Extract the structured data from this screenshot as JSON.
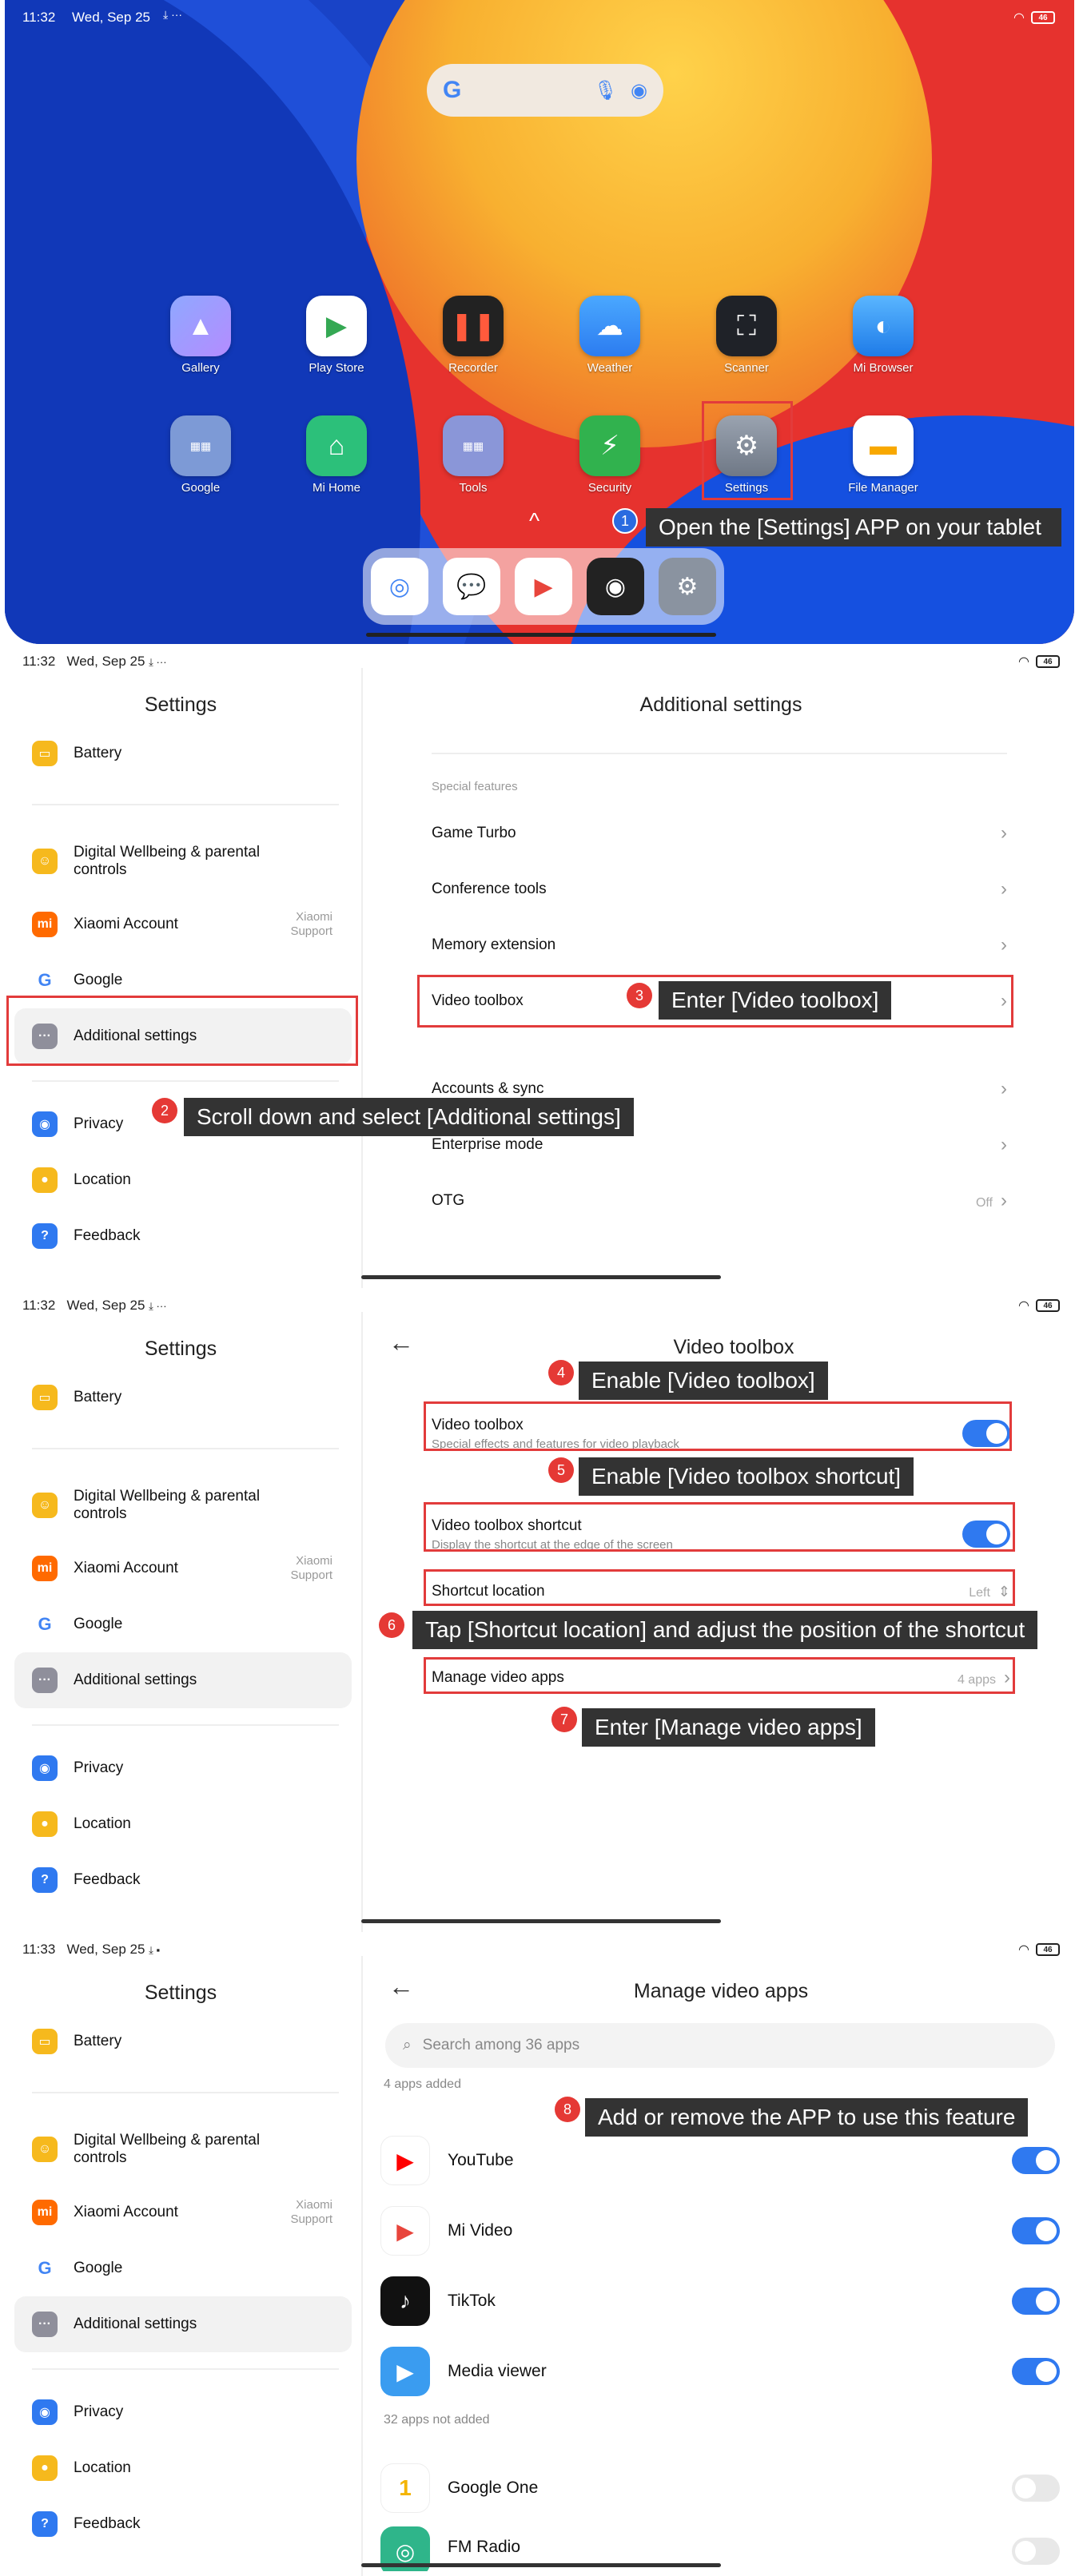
{
  "status": {
    "time1": "11:32",
    "date1": "Wed, Sep 25",
    "time4": "11:33",
    "battery": "46"
  },
  "home": {
    "apps_row1": [
      "Gallery",
      "Play Store",
      "Recorder",
      "Weather",
      "Scanner",
      "Mi Browser"
    ],
    "apps_row2": [
      "Google",
      "Mi Home",
      "Tools",
      "Security",
      "Settings",
      "File Manager"
    ],
    "step1_num": "1",
    "step1_text": "Open the [Settings] APP on your tablet",
    "up_arrow": "^"
  },
  "settings_left": {
    "title": "Settings",
    "battery": "Battery",
    "wellbeing": "Digital Wellbeing & parental controls",
    "xiaomi_account": "Xiaomi Account",
    "xiaomi_sub1": "Xiaomi",
    "xiaomi_sub2": "Support",
    "google": "Google",
    "additional": "Additional settings",
    "privacy": "Privacy",
    "location": "Location",
    "feedback": "Feedback"
  },
  "additional": {
    "title": "Additional settings",
    "section": "Special features",
    "game_turbo": "Game Turbo",
    "conference": "Conference tools",
    "memory": "Memory extension",
    "video_toolbox": "Video toolbox",
    "accounts": "Accounts & sync",
    "enterprise": "Enterprise mode",
    "otg": "OTG",
    "otg_value": "Off",
    "step2_num": "2",
    "step2_text": "Scroll down and select [Additional settings]",
    "step3_num": "3",
    "step3_text": "Enter [Video toolbox]"
  },
  "video_toolbox": {
    "title": "Video toolbox",
    "vt_label": "Video toolbox",
    "vt_desc": "Special effects and features for video playback",
    "shortcut_label": "Video toolbox shortcut",
    "shortcut_desc": "Display the shortcut at the edge of the screen",
    "location_label": "Shortcut location",
    "location_value": "Left",
    "manage_label": "Manage video apps",
    "manage_value": "4 apps",
    "step4_num": "4",
    "step4_text": "Enable [Video toolbox]",
    "step5_num": "5",
    "step5_text": "Enable [Video toolbox shortcut]",
    "step6_num": "6",
    "step6_text": "Tap [Shortcut location] and adjust the position of the shortcut",
    "step7_num": "7",
    "step7_text": "Enter [Manage video apps]"
  },
  "manage": {
    "title": "Manage video apps",
    "search_placeholder": "Search among 36 apps",
    "added": "4 apps added",
    "not_added": "32 apps not added",
    "apps_on": [
      "YouTube",
      "Mi Video",
      "TikTok",
      "Media viewer"
    ],
    "apps_off": [
      "Google One",
      "FM Radio"
    ],
    "step8_num": "8",
    "step8_text": "Add or remove the APP to use this feature"
  }
}
